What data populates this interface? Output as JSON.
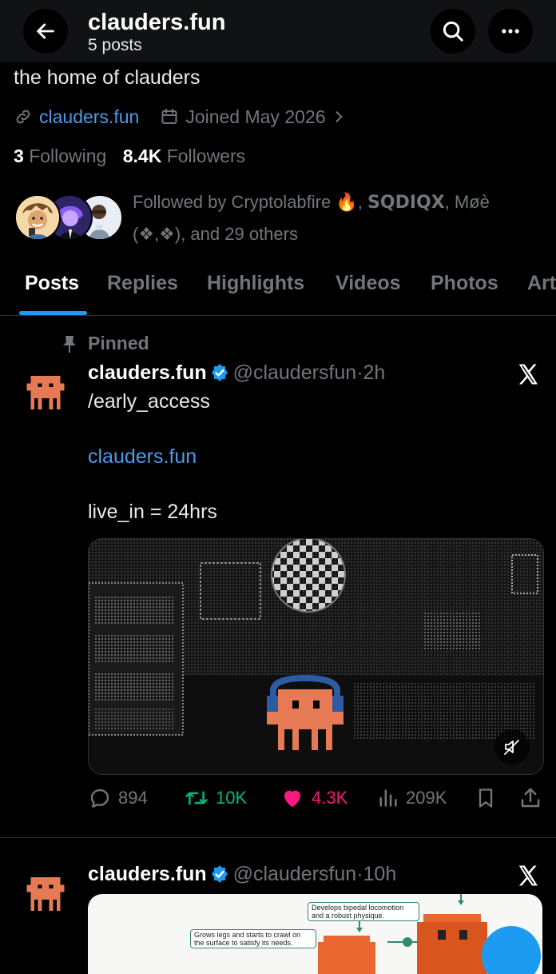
{
  "header": {
    "title": "clauders.fun",
    "post_count": "5 posts",
    "icons": [
      "back-arrow-icon",
      "search-icon",
      "more-icon"
    ]
  },
  "profile": {
    "bio": "the home of clauders",
    "website": "clauders.fun",
    "joined": "Joined May 2026",
    "following_count": "3",
    "following_label": "Following",
    "followers_count": "8.4K",
    "followers_label": "Followers",
    "followed_by_prefix": "Followed by Cryptolabfire",
    "followed_by_emoji": "🔥",
    "followed_by_sep": ",",
    "followed_by_bold": "SQDIQX",
    "followed_by_rest": ", Møè (❖,❖), and 29 others"
  },
  "tabs": [
    "Posts",
    "Replies",
    "Highlights",
    "Videos",
    "Photos",
    "Art"
  ],
  "posts": [
    {
      "pinned_label": "Pinned",
      "name": "clauders.fun",
      "handle": "@claudersfun",
      "time": "2h",
      "text1": "/early_access",
      "link": "clauders.fun",
      "text2": "live_in = 24hrs",
      "stats": {
        "replies": "894",
        "reposts": "10K",
        "likes": "4.3K",
        "views": "209K"
      }
    },
    {
      "name": "clauders.fun",
      "handle": "@claudersfun",
      "time": "10h",
      "diagram_text1": "Develops bipedal locomotion and a robust physique.",
      "diagram_text2": "Grows legs and starts to crawl on the surface to satisfy its needs."
    }
  ],
  "colors": {
    "accent": "#1d9bf0",
    "link": "#4b9bea",
    "repost": "#00ba7c",
    "like": "#f91880",
    "mascot": "#e57a54",
    "headphones": "#2e5aa3"
  }
}
